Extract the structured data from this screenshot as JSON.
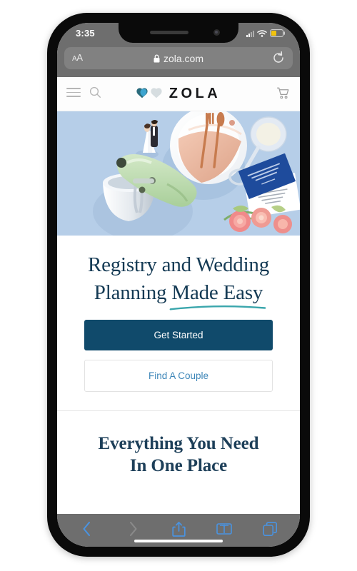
{
  "device": {
    "status_bar": {
      "time": "3:35",
      "signal_icon": "cellular-signal-icon",
      "wifi_icon": "wifi-icon",
      "battery_icon": "battery-icon",
      "battery_color": "#f2c30d"
    },
    "notch": {
      "speaker_icon": "speaker-grille-icon",
      "camera_icon": "front-camera-icon"
    },
    "home_indicator": "home-indicator"
  },
  "browser": {
    "name": "Safari",
    "chrome_color": "#6e6e6e",
    "url_bar": {
      "text_size_label": "AA",
      "lock_icon": "lock-icon",
      "url": "zola.com",
      "reload_icon": "reload-icon"
    },
    "toolbar": {
      "back_label": "Back",
      "back_icon": "chevron-left-icon",
      "forward_label": "Forward",
      "forward_icon": "chevron-right-icon",
      "share_label": "Share",
      "share_icon": "share-icon",
      "bookmarks_label": "Bookmarks",
      "bookmarks_icon": "book-icon",
      "tabs_label": "Tabs",
      "tabs_icon": "tabs-icon",
      "active_color": "#3f8fe0",
      "disabled_color": "#8a8a8a"
    }
  },
  "site": {
    "nav": {
      "menu_icon": "hamburger-menu-icon",
      "search_icon": "search-icon",
      "cart_icon": "shopping-cart-icon",
      "logo": {
        "wordmark": "ZOLA",
        "heart_icon": "double-heart-icon",
        "heart_dark_color": "#2a6b7c",
        "heart_light_color": "#d3dadd",
        "heart_mid_color": "#3fa9d6"
      }
    },
    "hero": {
      "image_alt": "wedding-flatlay-photo",
      "background_color": "#b6cee8",
      "objects": [
        "wedding-cake-topper",
        "plate-with-copper-cutlery",
        "wine-glass",
        "mint-stand-mixer",
        "blue-invitation-cards",
        "pink-flowers"
      ]
    },
    "headline": {
      "line1": "Registry and Wedding",
      "line2_prefix": "Planning ",
      "line2_underlined": "Made Easy",
      "text_color": "#143a54",
      "underline_color": "#3aa6ac"
    },
    "cta": {
      "primary_label": "Get Started",
      "primary_bg": "#104a6b",
      "primary_text_color": "#ffffff",
      "secondary_label": "Find A Couple",
      "secondary_text_color": "#3d86b8",
      "secondary_border_color": "#e2e2e2"
    },
    "section": {
      "heading_line1": "Everything You Need",
      "heading_line2": "In One Place",
      "heading_color": "#1d3f59"
    }
  }
}
